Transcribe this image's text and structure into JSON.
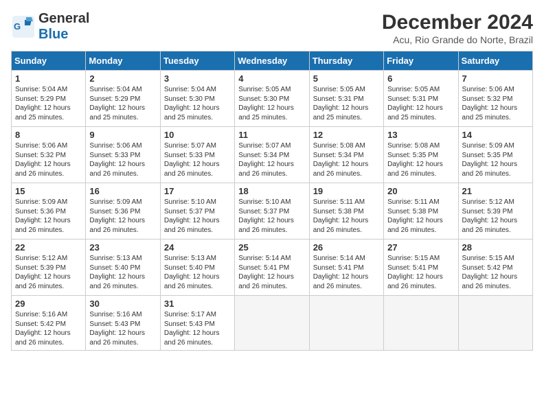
{
  "header": {
    "logo_general": "General",
    "logo_blue": "Blue",
    "month_title": "December 2024",
    "location": "Acu, Rio Grande do Norte, Brazil"
  },
  "weekdays": [
    "Sunday",
    "Monday",
    "Tuesday",
    "Wednesday",
    "Thursday",
    "Friday",
    "Saturday"
  ],
  "weeks": [
    [
      {
        "day": "1",
        "rise": "5:04 AM",
        "set": "5:29 PM",
        "hours": "12 hours and 25 minutes."
      },
      {
        "day": "2",
        "rise": "5:04 AM",
        "set": "5:29 PM",
        "hours": "12 hours and 25 minutes."
      },
      {
        "day": "3",
        "rise": "5:04 AM",
        "set": "5:30 PM",
        "hours": "12 hours and 25 minutes."
      },
      {
        "day": "4",
        "rise": "5:05 AM",
        "set": "5:30 PM",
        "hours": "12 hours and 25 minutes."
      },
      {
        "day": "5",
        "rise": "5:05 AM",
        "set": "5:31 PM",
        "hours": "12 hours and 25 minutes."
      },
      {
        "day": "6",
        "rise": "5:05 AM",
        "set": "5:31 PM",
        "hours": "12 hours and 25 minutes."
      },
      {
        "day": "7",
        "rise": "5:06 AM",
        "set": "5:32 PM",
        "hours": "12 hours and 25 minutes."
      }
    ],
    [
      {
        "day": "8",
        "rise": "5:06 AM",
        "set": "5:32 PM",
        "hours": "12 hours and 26 minutes."
      },
      {
        "day": "9",
        "rise": "5:06 AM",
        "set": "5:33 PM",
        "hours": "12 hours and 26 minutes."
      },
      {
        "day": "10",
        "rise": "5:07 AM",
        "set": "5:33 PM",
        "hours": "12 hours and 26 minutes."
      },
      {
        "day": "11",
        "rise": "5:07 AM",
        "set": "5:34 PM",
        "hours": "12 hours and 26 minutes."
      },
      {
        "day": "12",
        "rise": "5:08 AM",
        "set": "5:34 PM",
        "hours": "12 hours and 26 minutes."
      },
      {
        "day": "13",
        "rise": "5:08 AM",
        "set": "5:35 PM",
        "hours": "12 hours and 26 minutes."
      },
      {
        "day": "14",
        "rise": "5:09 AM",
        "set": "5:35 PM",
        "hours": "12 hours and 26 minutes."
      }
    ],
    [
      {
        "day": "15",
        "rise": "5:09 AM",
        "set": "5:36 PM",
        "hours": "12 hours and 26 minutes."
      },
      {
        "day": "16",
        "rise": "5:09 AM",
        "set": "5:36 PM",
        "hours": "12 hours and 26 minutes."
      },
      {
        "day": "17",
        "rise": "5:10 AM",
        "set": "5:37 PM",
        "hours": "12 hours and 26 minutes."
      },
      {
        "day": "18",
        "rise": "5:10 AM",
        "set": "5:37 PM",
        "hours": "12 hours and 26 minutes."
      },
      {
        "day": "19",
        "rise": "5:11 AM",
        "set": "5:38 PM",
        "hours": "12 hours and 26 minutes."
      },
      {
        "day": "20",
        "rise": "5:11 AM",
        "set": "5:38 PM",
        "hours": "12 hours and 26 minutes."
      },
      {
        "day": "21",
        "rise": "5:12 AM",
        "set": "5:39 PM",
        "hours": "12 hours and 26 minutes."
      }
    ],
    [
      {
        "day": "22",
        "rise": "5:12 AM",
        "set": "5:39 PM",
        "hours": "12 hours and 26 minutes."
      },
      {
        "day": "23",
        "rise": "5:13 AM",
        "set": "5:40 PM",
        "hours": "12 hours and 26 minutes."
      },
      {
        "day": "24",
        "rise": "5:13 AM",
        "set": "5:40 PM",
        "hours": "12 hours and 26 minutes."
      },
      {
        "day": "25",
        "rise": "5:14 AM",
        "set": "5:41 PM",
        "hours": "12 hours and 26 minutes."
      },
      {
        "day": "26",
        "rise": "5:14 AM",
        "set": "5:41 PM",
        "hours": "12 hours and 26 minutes."
      },
      {
        "day": "27",
        "rise": "5:15 AM",
        "set": "5:41 PM",
        "hours": "12 hours and 26 minutes."
      },
      {
        "day": "28",
        "rise": "5:15 AM",
        "set": "5:42 PM",
        "hours": "12 hours and 26 minutes."
      }
    ],
    [
      {
        "day": "29",
        "rise": "5:16 AM",
        "set": "5:42 PM",
        "hours": "12 hours and 26 minutes."
      },
      {
        "day": "30",
        "rise": "5:16 AM",
        "set": "5:43 PM",
        "hours": "12 hours and 26 minutes."
      },
      {
        "day": "31",
        "rise": "5:17 AM",
        "set": "5:43 PM",
        "hours": "12 hours and 26 minutes."
      },
      null,
      null,
      null,
      null
    ]
  ],
  "labels": {
    "sunrise": "Sunrise:",
    "sunset": "Sunset:",
    "daylight": "Daylight:"
  }
}
